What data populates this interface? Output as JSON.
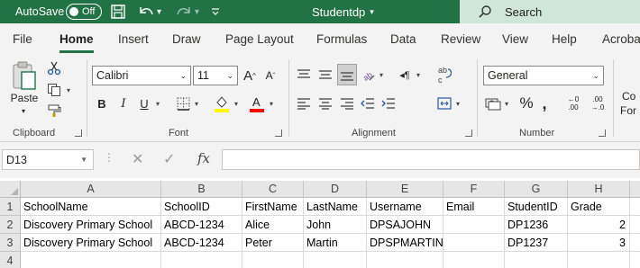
{
  "titlebar": {
    "autosave_label": "AutoSave",
    "autosave_state": "Off",
    "document_title": "Studentdp",
    "search_label": "Search"
  },
  "tabs": [
    "File",
    "Home",
    "Insert",
    "Draw",
    "Page Layout",
    "Formulas",
    "Data",
    "Review",
    "View",
    "Help",
    "Acrobat"
  ],
  "active_tab": "Home",
  "ribbon": {
    "clipboard": {
      "label": "Clipboard",
      "paste_label": "Paste"
    },
    "font": {
      "label": "Font",
      "font_name": "Calibri",
      "font_size": "11"
    },
    "alignment": {
      "label": "Alignment"
    },
    "number": {
      "label": "Number",
      "format": "General"
    },
    "next_group_partial": [
      "Co",
      "For"
    ]
  },
  "formula_bar": {
    "name_box": "D13",
    "fx_label": "fx",
    "formula": ""
  },
  "sheet": {
    "columns": [
      "A",
      "B",
      "C",
      "D",
      "E",
      "F",
      "G",
      "H"
    ],
    "row_numbers": [
      "1",
      "2",
      "3",
      "4"
    ],
    "rows": [
      [
        "SchoolName",
        "SchoolID",
        "FirstName",
        "LastName",
        "Username",
        "Email",
        "StudentID",
        "Grade"
      ],
      [
        "Discovery Primary School",
        "ABCD-1234",
        "Alice",
        "John",
        "DPSAJOHN",
        "",
        "DP1236",
        "2"
      ],
      [
        "Discovery Primary School",
        "ABCD-1234",
        "Peter",
        "Martin",
        "DPSPMARTIN",
        "",
        "DP1237",
        "3"
      ],
      [
        "",
        "",
        "",
        "",
        "",
        "",
        "",
        ""
      ]
    ]
  },
  "colors": {
    "excel_green": "#217346",
    "ribbon_bg": "#f3f3f3",
    "fill_highlight": "#ffff00",
    "font_color": "#ff0000"
  }
}
